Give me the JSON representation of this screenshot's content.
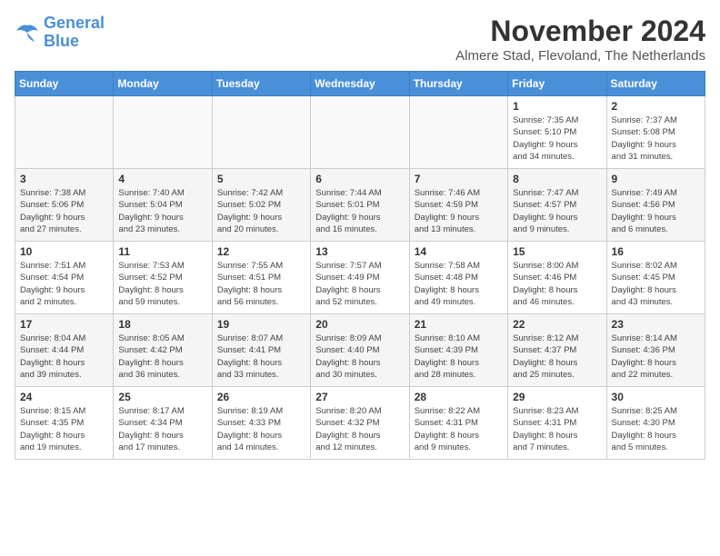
{
  "logo": {
    "line1": "General",
    "line2": "Blue"
  },
  "title": "November 2024",
  "location": "Almere Stad, Flevoland, The Netherlands",
  "weekdays": [
    "Sunday",
    "Monday",
    "Tuesday",
    "Wednesday",
    "Thursday",
    "Friday",
    "Saturday"
  ],
  "weeks": [
    [
      {
        "day": "",
        "info": ""
      },
      {
        "day": "",
        "info": ""
      },
      {
        "day": "",
        "info": ""
      },
      {
        "day": "",
        "info": ""
      },
      {
        "day": "",
        "info": ""
      },
      {
        "day": "1",
        "info": "Sunrise: 7:35 AM\nSunset: 5:10 PM\nDaylight: 9 hours\nand 34 minutes."
      },
      {
        "day": "2",
        "info": "Sunrise: 7:37 AM\nSunset: 5:08 PM\nDaylight: 9 hours\nand 31 minutes."
      }
    ],
    [
      {
        "day": "3",
        "info": "Sunrise: 7:38 AM\nSunset: 5:06 PM\nDaylight: 9 hours\nand 27 minutes."
      },
      {
        "day": "4",
        "info": "Sunrise: 7:40 AM\nSunset: 5:04 PM\nDaylight: 9 hours\nand 23 minutes."
      },
      {
        "day": "5",
        "info": "Sunrise: 7:42 AM\nSunset: 5:02 PM\nDaylight: 9 hours\nand 20 minutes."
      },
      {
        "day": "6",
        "info": "Sunrise: 7:44 AM\nSunset: 5:01 PM\nDaylight: 9 hours\nand 16 minutes."
      },
      {
        "day": "7",
        "info": "Sunrise: 7:46 AM\nSunset: 4:59 PM\nDaylight: 9 hours\nand 13 minutes."
      },
      {
        "day": "8",
        "info": "Sunrise: 7:47 AM\nSunset: 4:57 PM\nDaylight: 9 hours\nand 9 minutes."
      },
      {
        "day": "9",
        "info": "Sunrise: 7:49 AM\nSunset: 4:56 PM\nDaylight: 9 hours\nand 6 minutes."
      }
    ],
    [
      {
        "day": "10",
        "info": "Sunrise: 7:51 AM\nSunset: 4:54 PM\nDaylight: 9 hours\nand 2 minutes."
      },
      {
        "day": "11",
        "info": "Sunrise: 7:53 AM\nSunset: 4:52 PM\nDaylight: 8 hours\nand 59 minutes."
      },
      {
        "day": "12",
        "info": "Sunrise: 7:55 AM\nSunset: 4:51 PM\nDaylight: 8 hours\nand 56 minutes."
      },
      {
        "day": "13",
        "info": "Sunrise: 7:57 AM\nSunset: 4:49 PM\nDaylight: 8 hours\nand 52 minutes."
      },
      {
        "day": "14",
        "info": "Sunrise: 7:58 AM\nSunset: 4:48 PM\nDaylight: 8 hours\nand 49 minutes."
      },
      {
        "day": "15",
        "info": "Sunrise: 8:00 AM\nSunset: 4:46 PM\nDaylight: 8 hours\nand 46 minutes."
      },
      {
        "day": "16",
        "info": "Sunrise: 8:02 AM\nSunset: 4:45 PM\nDaylight: 8 hours\nand 43 minutes."
      }
    ],
    [
      {
        "day": "17",
        "info": "Sunrise: 8:04 AM\nSunset: 4:44 PM\nDaylight: 8 hours\nand 39 minutes."
      },
      {
        "day": "18",
        "info": "Sunrise: 8:05 AM\nSunset: 4:42 PM\nDaylight: 8 hours\nand 36 minutes."
      },
      {
        "day": "19",
        "info": "Sunrise: 8:07 AM\nSunset: 4:41 PM\nDaylight: 8 hours\nand 33 minutes."
      },
      {
        "day": "20",
        "info": "Sunrise: 8:09 AM\nSunset: 4:40 PM\nDaylight: 8 hours\nand 30 minutes."
      },
      {
        "day": "21",
        "info": "Sunrise: 8:10 AM\nSunset: 4:39 PM\nDaylight: 8 hours\nand 28 minutes."
      },
      {
        "day": "22",
        "info": "Sunrise: 8:12 AM\nSunset: 4:37 PM\nDaylight: 8 hours\nand 25 minutes."
      },
      {
        "day": "23",
        "info": "Sunrise: 8:14 AM\nSunset: 4:36 PM\nDaylight: 8 hours\nand 22 minutes."
      }
    ],
    [
      {
        "day": "24",
        "info": "Sunrise: 8:15 AM\nSunset: 4:35 PM\nDaylight: 8 hours\nand 19 minutes."
      },
      {
        "day": "25",
        "info": "Sunrise: 8:17 AM\nSunset: 4:34 PM\nDaylight: 8 hours\nand 17 minutes."
      },
      {
        "day": "26",
        "info": "Sunrise: 8:19 AM\nSunset: 4:33 PM\nDaylight: 8 hours\nand 14 minutes."
      },
      {
        "day": "27",
        "info": "Sunrise: 8:20 AM\nSunset: 4:32 PM\nDaylight: 8 hours\nand 12 minutes."
      },
      {
        "day": "28",
        "info": "Sunrise: 8:22 AM\nSunset: 4:31 PM\nDaylight: 8 hours\nand 9 minutes."
      },
      {
        "day": "29",
        "info": "Sunrise: 8:23 AM\nSunset: 4:31 PM\nDaylight: 8 hours\nand 7 minutes."
      },
      {
        "day": "30",
        "info": "Sunrise: 8:25 AM\nSunset: 4:30 PM\nDaylight: 8 hours\nand 5 minutes."
      }
    ]
  ]
}
